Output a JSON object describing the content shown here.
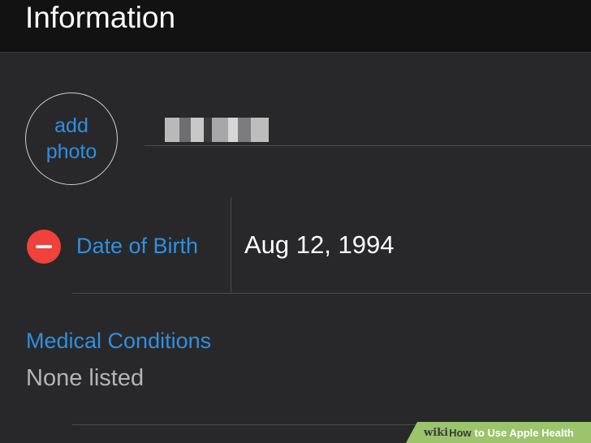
{
  "header": {
    "title": "Information"
  },
  "profile": {
    "photo_line1": "add",
    "photo_line2": "photo",
    "name_value": "[redacted name]"
  },
  "date_of_birth": {
    "label": "Date of Birth",
    "value": "Aug 12, 1994",
    "remove_icon": "minus-circle-icon",
    "remove_color": "#f0413b"
  },
  "medical_conditions": {
    "label": "Medical Conditions",
    "value": "None listed"
  },
  "watermark": {
    "wiki": "wiki",
    "how": "How",
    "rest": "to Use Apple Health"
  },
  "colors": {
    "accent": "#2f8fe0",
    "background": "#28282a",
    "header_background": "#121213",
    "watermark_background": "#9bc46d"
  }
}
